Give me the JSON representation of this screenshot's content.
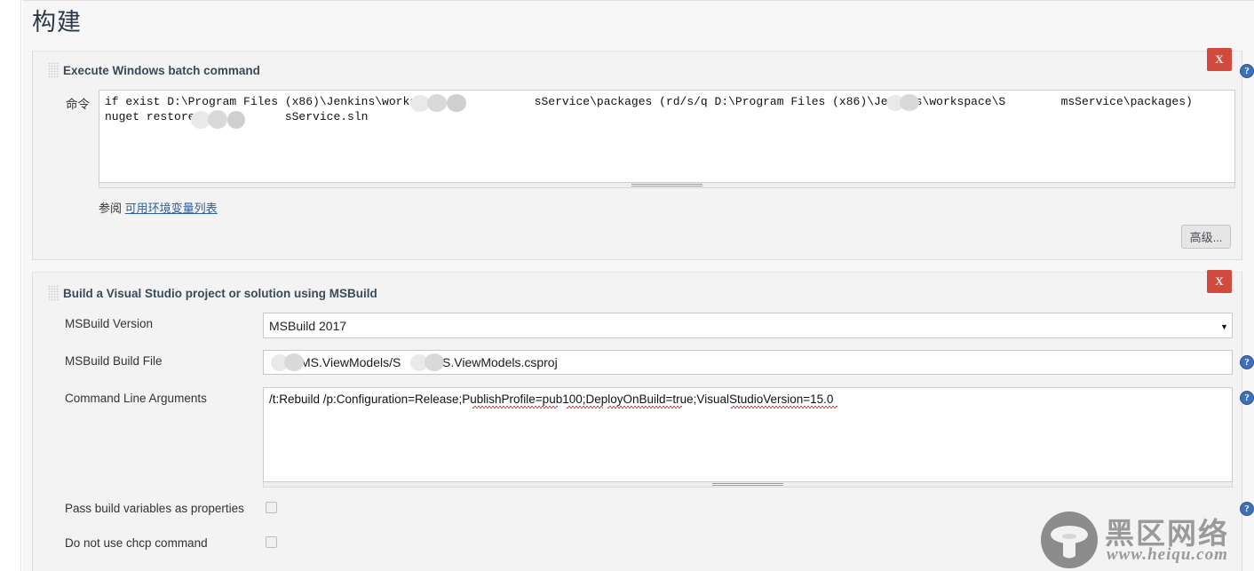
{
  "page": {
    "title": "构建"
  },
  "steps": [
    {
      "title": "Execute Windows batch command",
      "delete_label": "X",
      "command": {
        "label": "命令",
        "value": "if exist D:\\Program Files (x86)\\Jenkins\\workspace             sService\\packages (rd/s/q D:\\Program Files (x86)\\Jenkins\\workspace\\S        msService\\packages)\nnuget restore             sService.sln"
      },
      "hint": {
        "prefix": "参阅",
        "link_text": "可用环境变量列表"
      },
      "advanced_label": "高级..."
    },
    {
      "title": "Build a Visual Studio project or solution using MSBuild",
      "delete_label": "X",
      "fields": {
        "msbuild_version": {
          "label": "MSBuild Version",
          "value": "MSBuild 2017",
          "options": [
            "MSBuild 2017"
          ]
        },
        "build_file": {
          "label": "MSBuild Build File",
          "value": "        /MS.ViewModels/S        /MS.ViewModels.csproj"
        },
        "command_line_arguments": {
          "label": "Command Line Arguments",
          "value": "/t:Rebuild /p:Configuration=Release;PublishProfile=pub100;DeployOnBuild=true;VisualStudioVersion=15.0"
        },
        "pass_build_variables": {
          "label": "Pass build variables as properties",
          "checked": false
        },
        "no_chcp": {
          "label": "Do not use chcp command",
          "checked": false
        }
      }
    }
  ],
  "icons": {
    "help": "?",
    "dropdown_arrow": "▼"
  },
  "watermark": {
    "brand_cn": "黑区网络",
    "url": "www.heiqu.com"
  }
}
